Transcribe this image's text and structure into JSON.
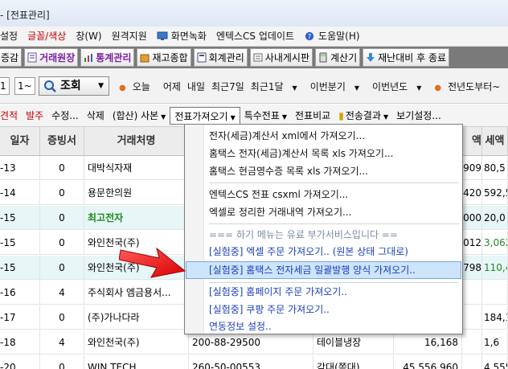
{
  "window": {
    "title": "- [전표관리]"
  },
  "menubar": {
    "items": [
      {
        "label": "설정",
        "red": false
      },
      {
        "label": "글꼴/색상",
        "red": true
      },
      {
        "label": "창(W)",
        "red": false
      },
      {
        "label": "원격지원",
        "red": false
      },
      {
        "label": "화면녹화",
        "red": false
      },
      {
        "label": "엔텍스CS 업데이트",
        "red": false
      },
      {
        "label": "도움말(H)",
        "red": false
      }
    ]
  },
  "toolbar1": {
    "items": [
      {
        "label": "증감"
      },
      {
        "label": "거래원장",
        "purple": true
      },
      {
        "label": "통계관리",
        "purple": true
      },
      {
        "label": "재고종합"
      },
      {
        "label": "회계관리"
      },
      {
        "label": "사내게시판"
      },
      {
        "label": "계산기"
      },
      {
        "label": "재난대비 후 종료"
      }
    ]
  },
  "toolbar2": {
    "combo1": "1",
    "combo2": "1~",
    "search_label": "조회",
    "periods": [
      "오늘",
      "어제",
      "내일",
      "최근7일",
      "최근1달",
      "이번분기",
      "이번년도",
      "전년도부터~"
    ]
  },
  "toolbar3": {
    "items": [
      {
        "label": "견적",
        "red": true
      },
      {
        "label": "발주",
        "red": true
      },
      {
        "label": "수정..."
      },
      {
        "label": "삭제"
      },
      {
        "label": "(합산) 사본",
        "dd": true
      },
      {
        "label": "전표가져오기",
        "dd": true,
        "active": true
      },
      {
        "label": "특수전표",
        "dd": true
      },
      {
        "label": "전표비교"
      },
      {
        "label": "전송결과",
        "dd": true
      },
      {
        "label": "보기설정..."
      }
    ]
  },
  "grid": {
    "headers": [
      "일자",
      "증빙서",
      "거래처명",
      "",
      "",
      "",
      "액",
      "세액"
    ],
    "rows": [
      {
        "date": "-13",
        "proof": "0",
        "client": "대박식자재",
        "c4": "",
        "c5": "",
        "c6": "",
        "amount": "909",
        "tax": "80,5",
        "hl": false,
        "green": false,
        "taxgreen": false
      },
      {
        "date": "-14",
        "proof": "0",
        "client": "용문한의원",
        "c4": "",
        "c5": "",
        "c6": "",
        "amount": "420",
        "tax": "592,5",
        "hl": false,
        "green": false,
        "taxgreen": false
      },
      {
        "date": "-15",
        "proof": "0",
        "client": "최고전자",
        "c4": "",
        "c5": "",
        "c6": "",
        "amount": "000",
        "tax": "20,0",
        "hl": true,
        "green": true,
        "taxgreen": false
      },
      {
        "date": "-15",
        "proof": "0",
        "client": "와인천국(주)",
        "c4": "",
        "c5": "",
        "c6": "",
        "amount": "012",
        "tax": "3,062",
        "hl": false,
        "green": false,
        "taxgreen": true
      },
      {
        "date": "-15",
        "proof": "0",
        "client": "와인천국(주)",
        "c4": "",
        "c5": "",
        "c6": "",
        "amount": "798",
        "tax": "110,47",
        "hl": true,
        "green": false,
        "taxgreen": true
      },
      {
        "date": "-16",
        "proof": "4",
        "client": "주식회사 엠금용서...",
        "c4": "",
        "c5": "",
        "c6": "",
        "amount": "",
        "tax": "",
        "hl": false,
        "green": false,
        "taxgreen": false
      },
      {
        "date": "-17",
        "proof": "0",
        "client": "(주)가나다라",
        "c4": "",
        "c5": "",
        "c6": "1,155",
        "amount": "",
        "tax": "184,1",
        "hl": false,
        "green": false,
        "taxgreen": false
      },
      {
        "date": "-18",
        "proof": "4",
        "client": "와인천국(주)",
        "c4": "200-88-29500",
        "c5": "테이블냉장",
        "c6": "16,168",
        "amount": "",
        "tax": "1,6",
        "hl": false,
        "green": false,
        "taxgreen": false
      },
      {
        "date": "-20",
        "proof": "0",
        "client": "WIN TECH",
        "c4": "260-50-00553",
        "c5": "각대(쪽대)",
        "c6": "45,556,960",
        "amount": "",
        "tax": "4,555,6",
        "hl": false,
        "green": false,
        "taxgreen": false
      }
    ]
  },
  "dropdown": {
    "items": [
      {
        "label": "전자(세금)계산서 xml에서 가져오기...",
        "style": "normal"
      },
      {
        "label": "홈택스 전자(세금)계산서 목록 xls 가져오기...",
        "style": "normal"
      },
      {
        "label": "홈택스 현금영수증 목록 xls 가져오기...",
        "style": "normal"
      },
      {
        "label": "엔텍스CS 전표 csxml 가져오기...",
        "style": "normal"
      },
      {
        "label": "엑셀로 정리한 거래내역 가져오기...",
        "style": "normal"
      },
      {
        "label": "=== 하기 메뉴는 유료 부가서비스입니다 ==",
        "style": "note"
      },
      {
        "label": "[실험중] 엑셀 주문 가져오기.. (원본 상태 그대로)",
        "style": "blue"
      },
      {
        "label": "[실험중] 홈택스 전자세금 일괄발행 양식 가져오기..",
        "style": "sel"
      },
      {
        "label": "[실험중] 홈페이지 주문 가져오기..",
        "style": "blue"
      },
      {
        "label": "[실험중] 쿠팡 주문 가져오기..",
        "style": "blue"
      },
      {
        "label": "연동정보 설정..",
        "style": "blue"
      }
    ]
  },
  "colors": {
    "accent_red": "#e01010",
    "menu_blue": "#1a3fb8",
    "highlight": "#cde4fb"
  }
}
